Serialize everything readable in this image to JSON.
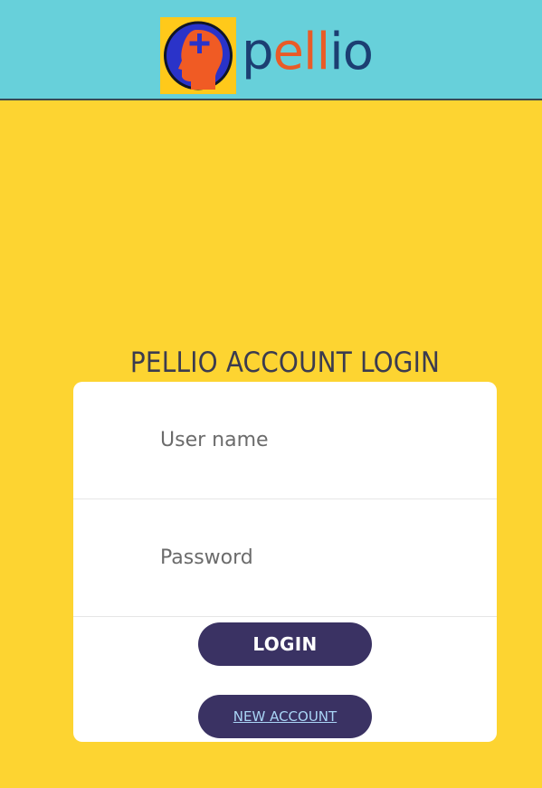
{
  "header": {
    "logo_text": [
      "p",
      "e",
      "l",
      "l",
      "i",
      "o"
    ],
    "logo_colors": [
      "#1C3E72",
      "#E95B27",
      "#E95B27",
      "#E95B27",
      "#1C3E72",
      "#1C3E72"
    ],
    "background": "#67D0DA"
  },
  "login": {
    "title": "PELLIO ACCOUNT LOGIN",
    "username_placeholder": "User name",
    "password_placeholder": "Password",
    "login_label": "LOGIN",
    "new_account_label": "NEW ACCOUNT"
  },
  "colors": {
    "page_background": "#FDD431",
    "button": "#3A3263",
    "link": "#A9D4F5"
  }
}
